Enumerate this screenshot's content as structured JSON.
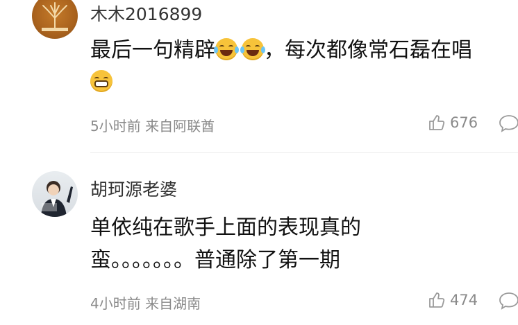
{
  "comments": [
    {
      "username": "木木2016899",
      "text_line1": "最后一句精辟",
      "text_line1_after": "，每次都像常石磊在唱",
      "meta": "5小时前 来自阿联酋",
      "likes": "676",
      "avatar_icon": "tree-logo-avatar",
      "emojis": [
        "laugh-cry",
        "laugh-cry",
        "grin"
      ]
    },
    {
      "username": "胡珂源老婆",
      "text_line1": "单依纯在歌手上面的表现真的",
      "text_line2": "蛮。。。。。。。普通除了第一期",
      "meta": "4小时前 来自湖南",
      "likes": "474",
      "avatar_icon": "person-photo-avatar"
    }
  ],
  "colors": {
    "meta_text": "#8a8a8a",
    "divider": "#ececec",
    "avatar1_bg": "#b06a22"
  }
}
